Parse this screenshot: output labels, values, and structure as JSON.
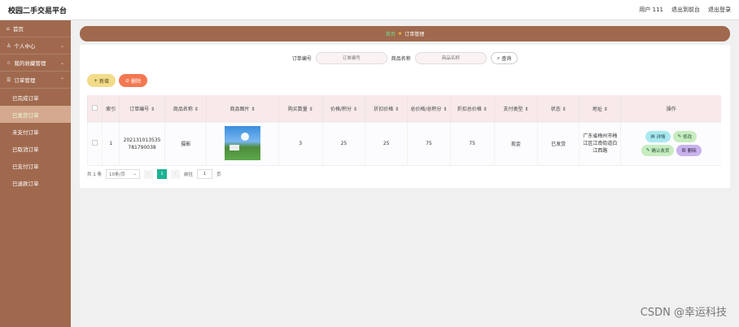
{
  "app": {
    "title": "校园二手交易平台"
  },
  "topbar": {
    "user": "用户 111",
    "back_front": "退出到前台",
    "logout": "退出登录"
  },
  "sidebar": {
    "items": [
      {
        "label": "首页",
        "icon": "home-icon"
      },
      {
        "label": "个人中心",
        "icon": "user-icon"
      },
      {
        "label": "我的收藏管理",
        "icon": "star-icon"
      },
      {
        "label": "订单管理",
        "icon": "order-icon"
      }
    ],
    "sub_items": [
      "已完成订单",
      "已发货订单",
      "未支付订单",
      "已取消订单",
      "已支付订单",
      "已退款订单"
    ],
    "active_sub": "已发货订单"
  },
  "breadcrumb": {
    "home": "首页",
    "current": "订单管理"
  },
  "search": {
    "order_label": "订单编号",
    "order_placeholder": "订单编号",
    "product_label": "商品名称",
    "product_placeholder": "商品名称",
    "query": "查询"
  },
  "actions": {
    "add": "新增",
    "delete": "删除"
  },
  "table": {
    "headers": [
      "",
      "索引",
      "订单编号 ⇕",
      "商品名称 ⇕",
      "商品图片 ⇕",
      "购买数量 ⇕",
      "价格/积分 ⇕",
      "折扣价格 ⇕",
      "总价格/总积分 ⇕",
      "折扣总价格 ⇕",
      "支付类型 ⇕",
      "状态 ⇕",
      "地址 ⇕",
      "操作"
    ],
    "rows": [
      {
        "index": "1",
        "order_no": "202131013535781790038",
        "product": "摄影",
        "qty": "3",
        "price": "25",
        "discount_price": "25",
        "total": "75",
        "discount_total": "75",
        "pay_type": "现金",
        "status": "已发货",
        "address": "广东省梅州市梅江区江南街道白江西路"
      }
    ],
    "ops": {
      "detail": "详情",
      "edit": "修改",
      "confirm": "确认收货",
      "delete": "删除"
    }
  },
  "pager": {
    "total": "共 1 条",
    "size": "10条/页",
    "page": "1",
    "goto_label": "前往",
    "goto_value": "1",
    "page_unit": "页"
  },
  "watermark": "CSDN @幸运科技",
  "colors": {
    "sidebar": "#a0694e",
    "accent": "#1bb394"
  }
}
